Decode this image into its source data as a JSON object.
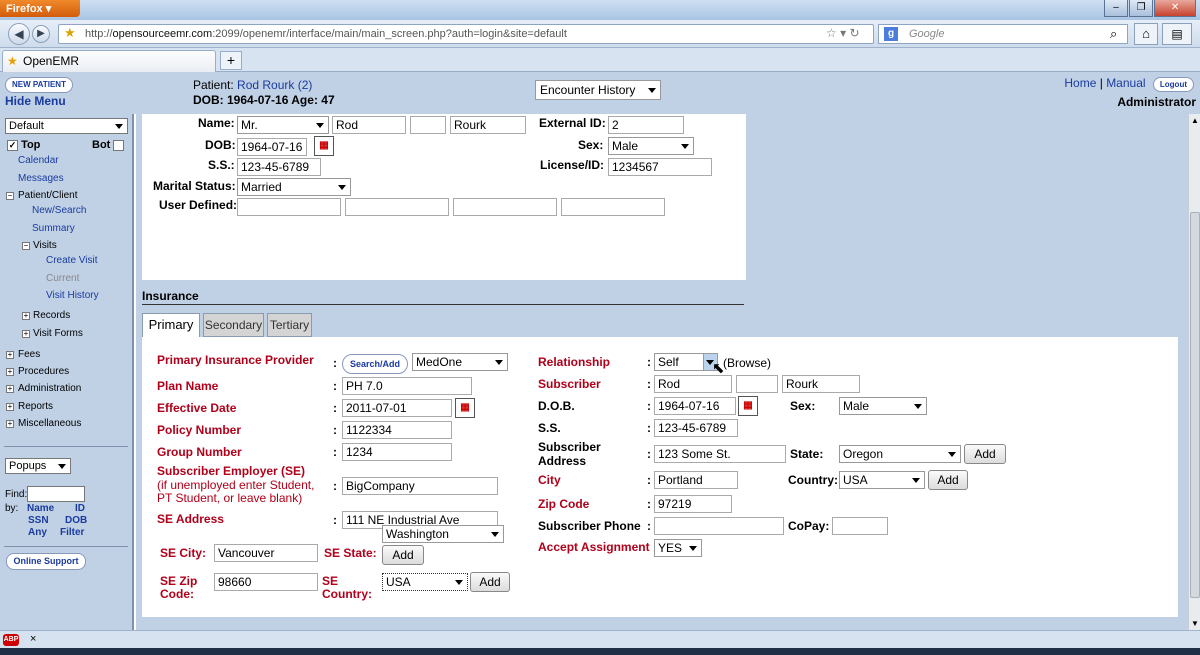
{
  "browser": {
    "app_button": "Firefox",
    "url_prefix": "http://",
    "url_host": "opensourceemr.com",
    "url_rest": ":2099/openemr/interface/main/main_screen.php?auth=login&site=default",
    "search_placeholder": "Google",
    "tab_title": "OpenEMR",
    "new_tab": "+"
  },
  "header": {
    "new_patient": "NEW PATIENT",
    "hide_menu": "Hide Menu",
    "patient_label": "Patient:",
    "patient_name": "Rod Rourk (2)",
    "dob_line": "DOB: 1964-07-16 Age: 47",
    "encounter_select": "Encounter History",
    "home": "Home",
    "manual": "Manual",
    "separator": "|",
    "logout": "Logout",
    "user": "Administrator"
  },
  "leftnav": {
    "layout_select": "Default",
    "top": "Top",
    "bot": "Bot",
    "items": [
      "Calendar",
      "Messages"
    ],
    "patient_client": "Patient/Client",
    "new_search": "New/Search",
    "summary": "Summary",
    "visits": "Visits",
    "create_visit": "Create Visit",
    "current": "Current",
    "visit_history": "Visit History",
    "records": "Records",
    "visit_forms": "Visit Forms",
    "fees": "Fees",
    "procedures": "Procedures",
    "administration": "Administration",
    "reports": "Reports",
    "miscellaneous": "Miscellaneous",
    "popups": "Popups",
    "find": "Find:",
    "by": "by:",
    "find_links": [
      "Name",
      "ID",
      "SSN",
      "DOB",
      "Any",
      "Filter"
    ],
    "online_support": "Online Support"
  },
  "demographics": {
    "name_label": "Name:",
    "title": "Mr.",
    "first": "Rod",
    "middle": "",
    "last": "Rourk",
    "dob_label": "DOB:",
    "dob": "1964-07-16",
    "ss_label": "S.S.:",
    "ss": "123-45-6789",
    "marital_label": "Marital Status:",
    "marital": "Married",
    "user_defined_label": "User Defined:",
    "external_id_label": "External ID:",
    "external_id": "2",
    "sex_label": "Sex:",
    "sex": "Male",
    "license_label": "License/ID:",
    "license": "1234567"
  },
  "insurance": {
    "title": "Insurance",
    "tabs": [
      "Primary",
      "Secondary",
      "Tertiary"
    ],
    "provider_label": "Primary Insurance Provider",
    "search_add": "Search/Add",
    "provider": "MedOne",
    "plan_label": "Plan Name",
    "plan": "PH 7.0",
    "effective_label": "Effective Date",
    "effective": "2011-07-01",
    "policy_label": "Policy Number",
    "policy": "1122334",
    "group_label": "Group Number",
    "group": "1234",
    "employer_label": "Subscriber Employer (SE)",
    "employer_note": "(if unemployed enter Student, PT Student, or leave blank)",
    "employer": "BigCompany",
    "se_address_label": "SE Address",
    "se_address": "111 NE Industrial Ave",
    "se_city_label": "SE City:",
    "se_city": "Vancouver",
    "se_state_label": "SE State:",
    "se_state": "Washington",
    "se_zip_label": "SE Zip Code:",
    "se_zip": "98660",
    "se_country_label": "SE Country:",
    "se_country": "USA",
    "add": "Add",
    "relationship_label": "Relationship",
    "relationship": "Self",
    "browse": "(Browse)",
    "subscriber_label": "Subscriber",
    "sub_first": "Rod",
    "sub_middle": "",
    "sub_last": "Rourk",
    "sub_dob_label": "D.O.B.",
    "sub_dob": "1964-07-16",
    "sub_sex_label": "Sex:",
    "sub_sex": "Male",
    "sub_ss_label": "S.S.",
    "sub_ss": "123-45-6789",
    "sub_address_label": "Subscriber Address",
    "sub_address": "123 Some St.",
    "state_label": "State:",
    "state": "Oregon",
    "city_label": "City",
    "city": "Portland",
    "country_label": "Country:",
    "country": "USA",
    "zip_label": "Zip Code",
    "zip": "97219",
    "phone_label": "Subscriber Phone",
    "phone": "",
    "copay_label": "CoPay:",
    "copay": "",
    "accept_label": "Accept Assignment",
    "accept": "YES",
    "colon": ":"
  },
  "status": {
    "abp": "ABP",
    "close": "×"
  }
}
